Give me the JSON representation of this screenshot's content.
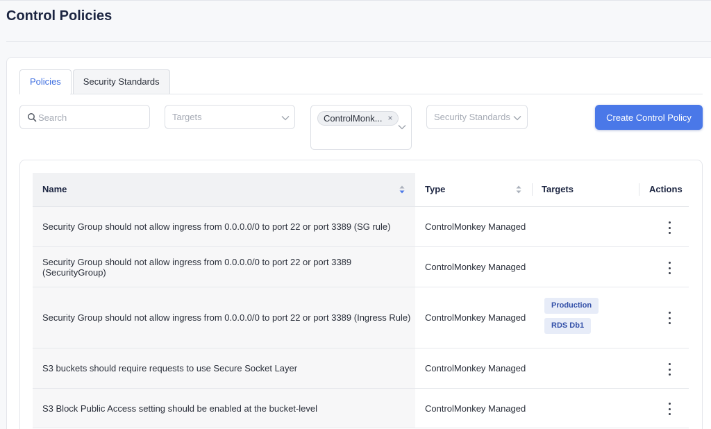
{
  "page": {
    "title": "Control Policies"
  },
  "tabs": [
    {
      "label": "Policies",
      "active": true
    },
    {
      "label": "Security Standards",
      "active": false
    }
  ],
  "filters": {
    "search_placeholder": "Search",
    "targets_placeholder": "Targets",
    "type_chip": "ControlMonk...",
    "chip_remove": "×",
    "security_standards_placeholder": "Security Standards"
  },
  "actions": {
    "create_button": "Create Control Policy"
  },
  "table": {
    "columns": {
      "name": "Name",
      "type": "Type",
      "targets": "Targets",
      "actions": "Actions"
    },
    "rows": [
      {
        "name": "Security Group should not allow ingress from 0.0.0.0/0 to port 22 or port 3389 (SG rule)",
        "type": "ControlMonkey Managed",
        "targets": []
      },
      {
        "name": "Security Group should not allow ingress from 0.0.0.0/0 to port 22 or port 3389 (SecurityGroup)",
        "type": "ControlMonkey Managed",
        "targets": []
      },
      {
        "name": "Security Group should not allow ingress from 0.0.0.0/0 to port 22 or port 3389 (Ingress Rule)",
        "type": "ControlMonkey Managed",
        "targets": [
          "Production",
          "RDS Db1"
        ]
      },
      {
        "name": "S3 buckets should require requests to use Secure Socket Layer",
        "type": "ControlMonkey Managed",
        "targets": []
      },
      {
        "name": "S3 Block Public Access setting should be enabled at the bucket-level",
        "type": "ControlMonkey Managed",
        "targets": []
      }
    ]
  },
  "colors": {
    "accent": "#4a78e8",
    "tab_active": "#3f6fe0",
    "tag_bg": "#e7ecf8",
    "tag_text": "#3350a8",
    "sort_active": "#4a78e8"
  },
  "icons": {
    "search": "search-icon",
    "chevron": "chevron-down-icon",
    "sort": "sort-icon",
    "menu": "more-vertical-icon"
  }
}
